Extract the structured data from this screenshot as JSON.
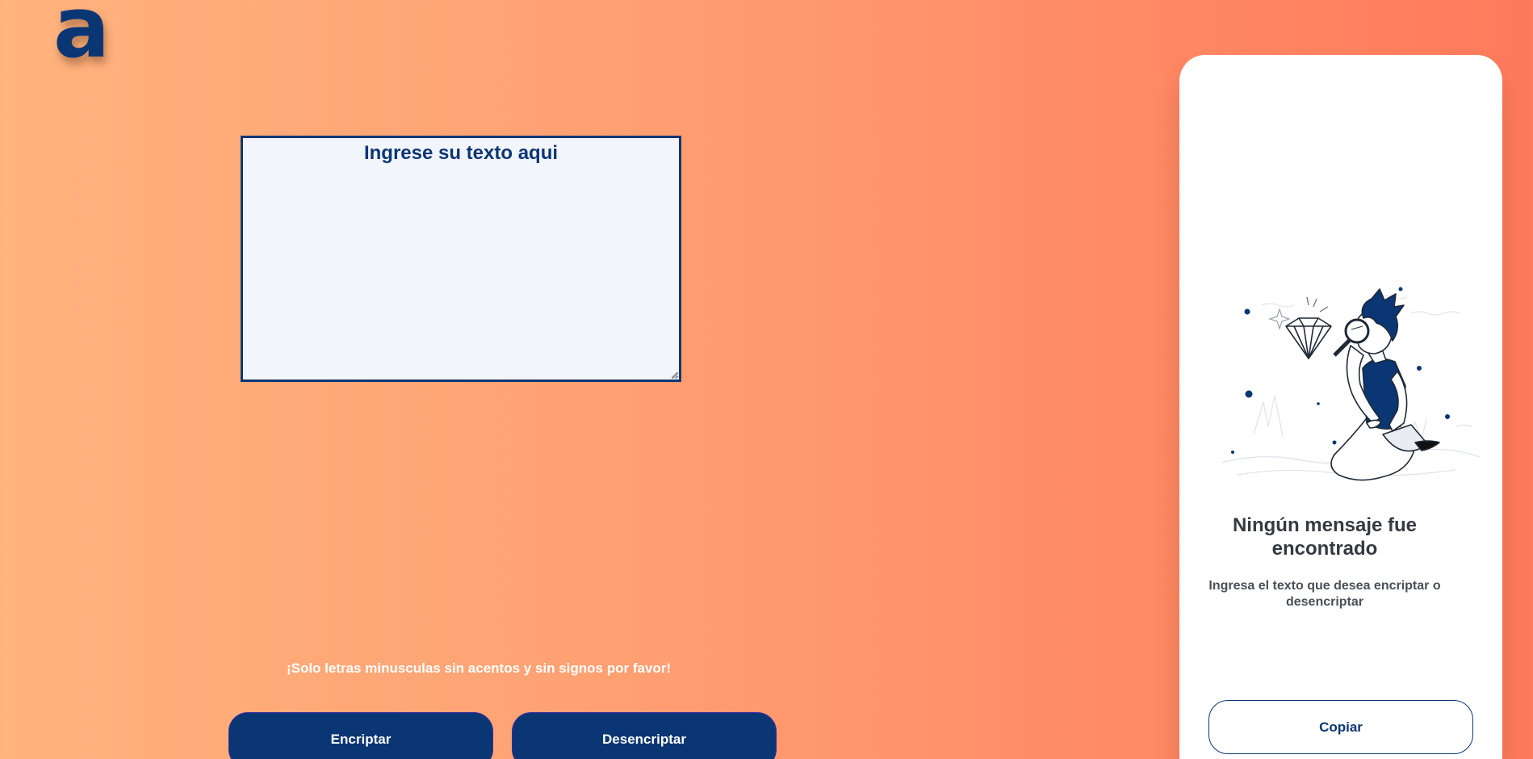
{
  "logo": {
    "text": "a"
  },
  "input": {
    "placeholder": "Ingrese su texto aqui",
    "value": ""
  },
  "hint": {
    "text": "¡Solo letras minusculas sin acentos y sin signos por favor!"
  },
  "buttons": {
    "encrypt": "Encriptar",
    "decrypt": "Desencriptar"
  },
  "result_panel": {
    "title": "Ningún mensaje fue encontrado",
    "description": "Ingresa el texto que desea encriptar o desencriptar",
    "copy_button": "Copiar",
    "illustration": "person-with-magnifying-glass-and-diamond"
  },
  "colors": {
    "primary": "#0b3674",
    "input_background": "#f3f5fd",
    "gradient_start": "#ffb37d",
    "gradient_end": "#ff7a5c",
    "panel_background": "#ffffff"
  }
}
